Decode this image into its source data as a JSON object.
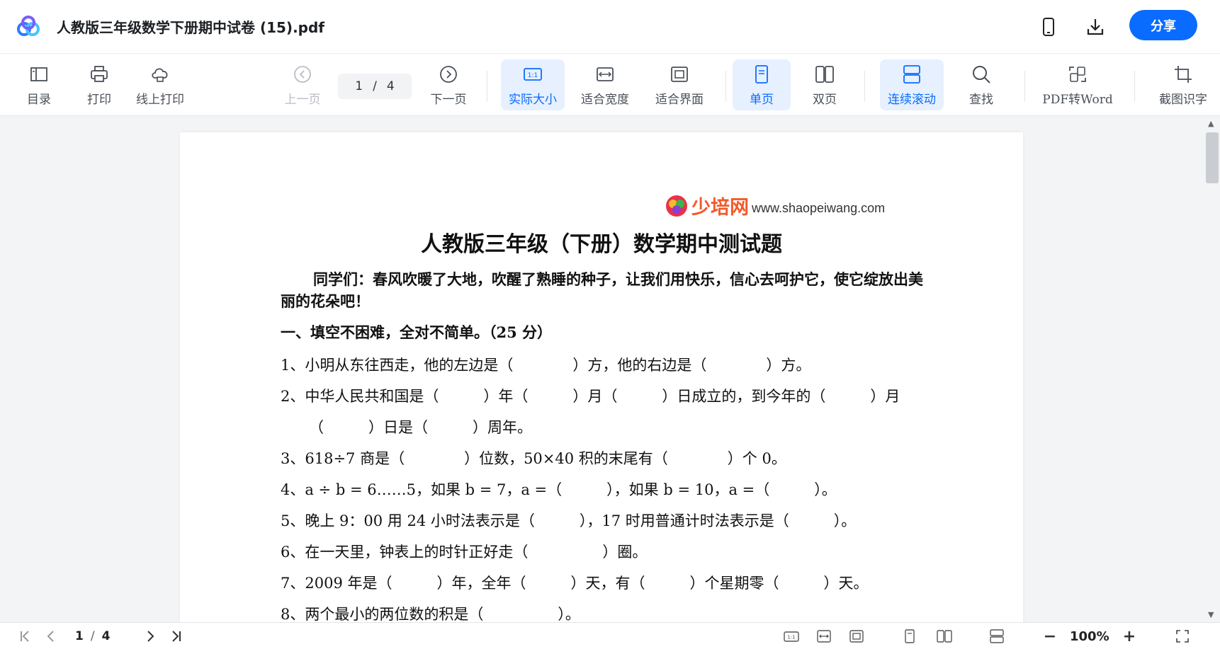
{
  "titlebar": {
    "doc_title": "人教版三年级数学下册期中试卷 (15).pdf",
    "share_label": "分享",
    "icons": [
      "app-logo-icon",
      "phone-icon",
      "download-icon"
    ]
  },
  "toolbar": {
    "toc": "目录",
    "print": "打印",
    "online_print": "线上打印",
    "prev": "上一页",
    "page_current": "1",
    "page_sep": "/",
    "page_total": "4",
    "next": "下一页",
    "actual_size": "实际大小",
    "fit_width": "适合宽度",
    "fit_page": "适合界面",
    "single_page": "单页",
    "double_page": "双页",
    "continuous": "连续滚动",
    "find": "查找",
    "pdf_to_word": "PDF转Word",
    "ocr": "截图识字"
  },
  "document": {
    "watermark_brand": "少培网",
    "watermark_url": "www.shaopeiwang.com",
    "title": "人教版三年级（下册）数学期中测试题",
    "intro": "同学们：春风吹暖了大地，吹醒了熟睡的种子，让我们用快乐，信心去呵护它，使它绽放出美丽的花朵吧！",
    "section1": "一、填空不困难，全对不简单。（25 分）",
    "questions": [
      "1、小明从东往西走，他的左边是（　　　　）方，他的右边是（　　　　）方。",
      "2、中华人民共和国是（　　　）年（　　　）月（　　　）日成立的，到今年的（　　　）月",
      "（　　　）日是（　　　）周年。",
      "3、618÷7 商是（　　　　）位数，50×40 积的末尾有（　　　　）个 0。",
      "4、a ÷ b = 6……5，如果 b = 7，a =（　　　），如果 b = 10，a =（　　　）。",
      "5、晚上 9：00 用 24 小时法表示是（　　　），17 时用普通计时法表示是（　　　）。",
      "6、在一天里，钟表上的时针正好走（　　　　　）圈。",
      "7、2009 年是（　　　）年，全年（　　　）天，有（　　　）个星期零（　　　）天。",
      "8、两个最小的两位数的积是（　　　　　）。"
    ]
  },
  "statusbar": {
    "page_current": "1",
    "page_sep": "/",
    "page_total": "4",
    "zoom": "100%"
  },
  "colors": {
    "accent": "#0a6cff",
    "active_bg": "#e6f0ff",
    "brand_orange": "#f25a2a"
  }
}
